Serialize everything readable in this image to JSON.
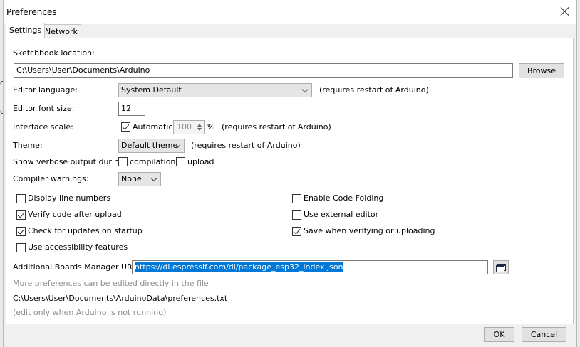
{
  "window": {
    "title": "Preferences"
  },
  "tabs": [
    {
      "label": "Settings"
    },
    {
      "label": "Network"
    }
  ],
  "sketchbook": {
    "label": "Sketchbook location:",
    "path": "C:\\Users\\User\\Documents\\Arduino",
    "browse_label": "Browse"
  },
  "editor_language": {
    "label": "Editor language:",
    "value": "System Default",
    "note": "(requires restart of Arduino)"
  },
  "editor_font_size": {
    "label": "Editor font size:",
    "value": "12"
  },
  "interface_scale": {
    "label": "Interface scale:",
    "automatic_label": "Automatic",
    "automatic_checked": true,
    "value": "100",
    "unit": "%",
    "note": "(requires restart of Arduino)"
  },
  "theme": {
    "label": "Theme:",
    "value": "Default theme",
    "note": "(requires restart of Arduino)"
  },
  "verbose": {
    "label": "Show verbose output during:",
    "compilation_label": "compilation",
    "compilation_checked": false,
    "upload_label": "upload",
    "upload_checked": false
  },
  "compiler_warnings": {
    "label": "Compiler warnings:",
    "value": "None"
  },
  "options_left": [
    {
      "label": "Display line numbers",
      "checked": false
    },
    {
      "label": "Verify code after upload",
      "checked": true
    },
    {
      "label": "Check for updates on startup",
      "checked": true
    },
    {
      "label": "Use accessibility features",
      "checked": false
    }
  ],
  "options_right": [
    {
      "label": "Enable Code Folding",
      "checked": false
    },
    {
      "label": "Use external editor",
      "checked": false
    },
    {
      "label": "Save when verifying or uploading",
      "checked": true
    }
  ],
  "boards_manager": {
    "label": "Additional Boards Manager URLs:",
    "value": "https://dl.espressif.com/dl/package_esp32_index.json",
    "visible_value": "nttps://dl.espressif.com/dl/package_esp32_index.json"
  },
  "footer": {
    "more_prefs": "More preferences can be edited directly in the file",
    "file_path": "C:\\Users\\User\\Documents\\ArduinoData\\preferences.txt",
    "edit_note": "(edit only when Arduino is not running)"
  },
  "buttons": {
    "ok": "OK",
    "cancel": "Cancel"
  },
  "background_edge_glyphs": [
    "o",
    "o"
  ],
  "colors": {
    "selection": "#0078d7"
  }
}
